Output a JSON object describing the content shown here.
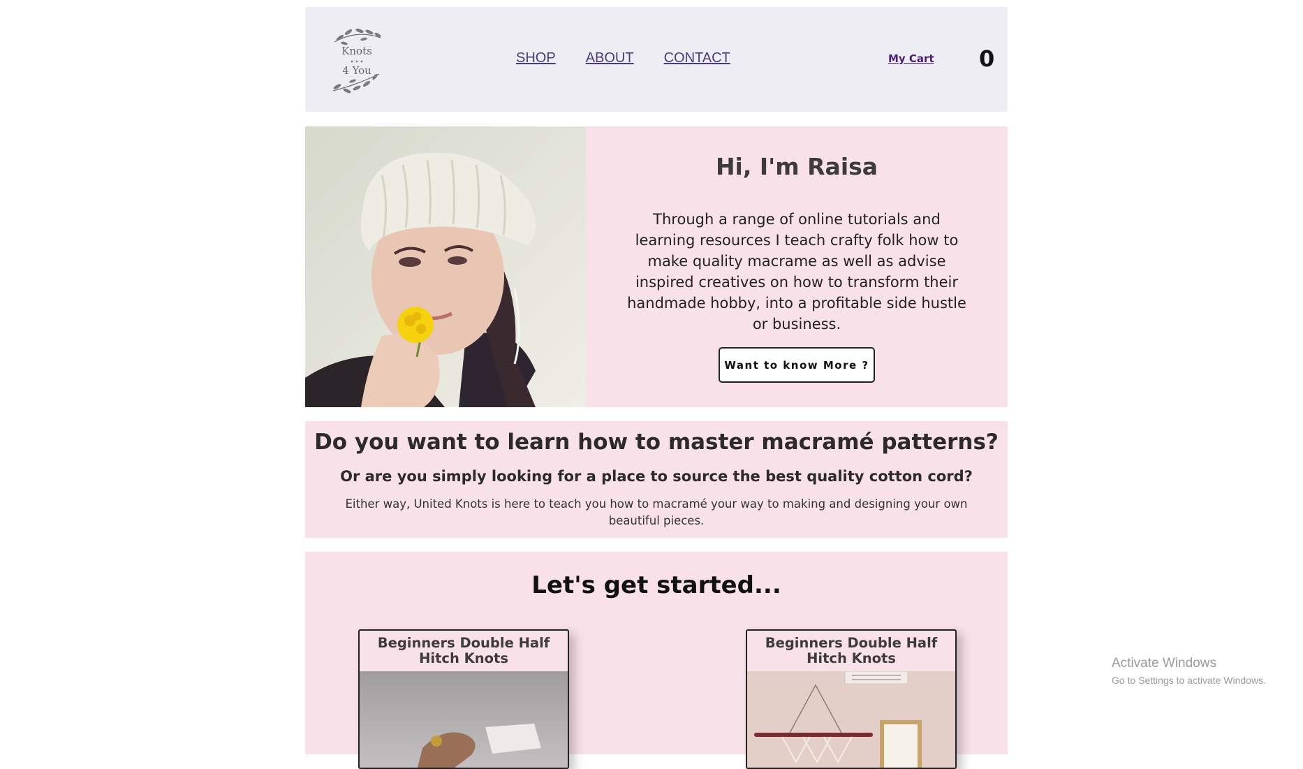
{
  "header": {
    "logo": {
      "line1": "Knots",
      "line2": "4 You"
    },
    "nav": [
      "SHOP",
      "ABOUT",
      "CONTACT"
    ],
    "cart_label": "My Cart",
    "cart_count": "0"
  },
  "hero": {
    "title": "Hi, I'm Raisa",
    "text": "Through a range of online tutorials and learning resources I teach crafty folk how to make quality macrame as well as advise inspired creatives on how to transform their handmade hobby, into a profitable side hustle or business.",
    "button": "Want to know More ?"
  },
  "intro": {
    "heading": "Do you want to learn how to master macramé patterns?",
    "subheading": "Or are you simply looking for a place to source the best quality cotton cord?",
    "text": "Either way, United Knots is here to teach you how to macramé your way to making and designing your own beautiful pieces."
  },
  "started": {
    "heading": "Let's get started...",
    "cards": [
      {
        "title": "Beginners Double Half Hitch Knots"
      },
      {
        "title": "Beginners Double Half Hitch Knots"
      }
    ]
  },
  "watermark": {
    "line1": "Activate Windows",
    "line2": "Go to Settings to activate Windows."
  }
}
